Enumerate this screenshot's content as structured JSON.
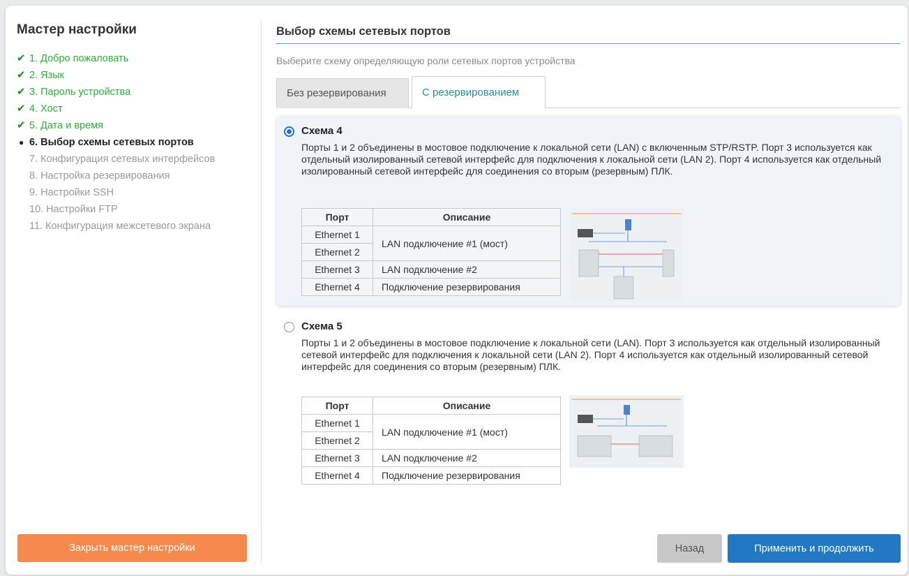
{
  "sidebar": {
    "title": "Мастер настройки",
    "steps": [
      {
        "label": "1. Добро пожаловать",
        "status": "done"
      },
      {
        "label": "2. Язык",
        "status": "done"
      },
      {
        "label": "3. Пароль устройства",
        "status": "done"
      },
      {
        "label": "4. Хост",
        "status": "done"
      },
      {
        "label": "5. Дата и время",
        "status": "done"
      },
      {
        "label": "6. Выбор схемы сетевых портов",
        "status": "current"
      },
      {
        "label": "7. Конфигурация сетевых интерфейсов",
        "status": "pending"
      },
      {
        "label": "8. Настройка резервирования",
        "status": "pending"
      },
      {
        "label": "9. Настройки SSH",
        "status": "pending"
      },
      {
        "label": "10. Настройки FTP",
        "status": "pending"
      },
      {
        "label": "11. Конфигурация межсетевого экрана",
        "status": "pending"
      }
    ],
    "done_mark": "✔",
    "current_mark": "●",
    "close_button": "Закрыть мастер настройки"
  },
  "main": {
    "title": "Выбор схемы сетевых портов",
    "subtitle": "Выберите схему определяющую роли сетевых портов устройства",
    "tabs": [
      {
        "label": "Без резервирования",
        "active": false
      },
      {
        "label": "С резервированием",
        "active": true
      }
    ],
    "table_headers": {
      "port": "Порт",
      "description": "Описание"
    },
    "schemes": [
      {
        "name": "Схема 4",
        "selected": true,
        "description": "Порты 1 и 2 объединены в мостовое подключение к локальной сети (LAN) с включенным STP/RSTP. Порт 3 используется как отдельный изолированный сетевой интерфейс для подключения к локальной сети (LAN 2). Порт 4 используется как отдельный изолированный сетевой интерфейс для соединения со вторым (резервным) ПЛК.",
        "rows": [
          {
            "port": "Ethernet 1",
            "desc": "LAN подключение #1 (мост)"
          },
          {
            "port": "Ethernet 2",
            "desc": ""
          },
          {
            "port": "Ethernet 3",
            "desc": "LAN подключение #2"
          },
          {
            "port": "Ethernet 4",
            "desc": "Подключение резервирования"
          }
        ]
      },
      {
        "name": "Схема 5",
        "selected": false,
        "description": "Порты 1 и 2 объединены в мостовое подключение к локальной сети (LAN). Порт 3 используется как отдельный изолированный сетевой интерфейс для подключения к локальной сети (LAN 2). Порт 4 используется как отдельный изолированный сетевой интерфейс для соединения со вторым (резервным) ПЛК.",
        "rows": [
          {
            "port": "Ethernet 1",
            "desc": "LAN подключение #1 (мост)"
          },
          {
            "port": "Ethernet 2",
            "desc": ""
          },
          {
            "port": "Ethernet 3",
            "desc": "LAN подключение #2"
          },
          {
            "port": "Ethernet 4",
            "desc": "Подключение резервирования"
          }
        ]
      }
    ],
    "back_button": "Назад",
    "apply_button": "Применить и продолжить"
  },
  "colors": {
    "accent": "#2a8c99",
    "done_green": "#2eae3b",
    "close_orange": "#f6894e",
    "apply_blue": "#2378c3",
    "radio_blue": "#1a73e8"
  }
}
